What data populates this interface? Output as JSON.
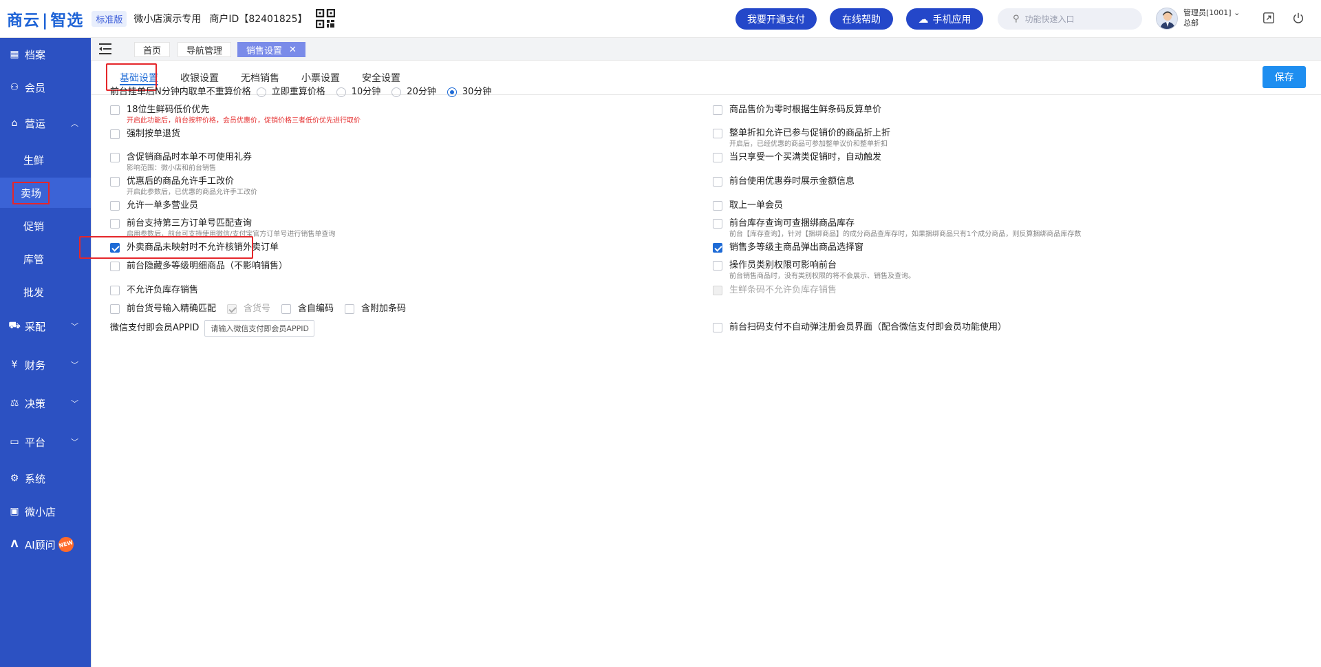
{
  "header": {
    "logo_left": "商云",
    "logo_right": "智选",
    "edition": "标准版",
    "store": "微小店演示专用",
    "merchant": "商户ID【82401825】",
    "btn_pay": "我要开通支付",
    "btn_help": "在线帮助",
    "btn_mobile": "手机应用",
    "search_placeholder": "功能快速入口",
    "user_name": "管理员[1001]",
    "user_dept": "总部"
  },
  "sidebar": {
    "items": [
      {
        "label": "档案",
        "icon": "archive-icon"
      },
      {
        "label": "会员",
        "icon": "member-icon"
      },
      {
        "label": "营运",
        "icon": "operation-icon"
      },
      {
        "label": "采配",
        "icon": "purchase-icon"
      },
      {
        "label": "财务",
        "icon": "finance-icon"
      },
      {
        "label": "决策",
        "icon": "decision-icon"
      },
      {
        "label": "平台",
        "icon": "platform-icon"
      },
      {
        "label": "系统",
        "icon": "system-icon"
      },
      {
        "label": "微小店",
        "icon": "shop-icon"
      },
      {
        "label": "AI顾问",
        "icon": "ai-icon"
      }
    ],
    "subitems": [
      "生鲜",
      "卖场",
      "促销",
      "库管",
      "批发"
    ],
    "new_badge": "NEW"
  },
  "tabs": {
    "home": "首页",
    "nav": "导航管理",
    "sales": "销售设置"
  },
  "settabs": [
    "基础设置",
    "收银设置",
    "无档销售",
    "小票设置",
    "安全设置"
  ],
  "save_label": "保存",
  "reprice": {
    "label": "前台挂单后N分钟内取单不重算价格",
    "options": [
      "立即重算价格",
      "10分钟",
      "20分钟",
      "30分钟"
    ],
    "selected": "30分钟"
  },
  "left": {
    "r1": {
      "label": "18位生鲜码低价优先",
      "note": "开启此功能后，前台按秤价格，会员优惠价，促销价格三者低价优先进行取价"
    },
    "r2": {
      "label": "强制按单退货"
    },
    "r3": {
      "label": "含促销商品时本单不可使用礼券",
      "note": "影响范围：微小店和前台销售"
    },
    "r4": {
      "label": "优惠后的商品允许手工改价",
      "note": "开启此参数后，已优惠的商品允许手工改价"
    },
    "r5": {
      "label": "允许一单多营业员"
    },
    "r6": {
      "label": "前台支持第三方订单号匹配查询",
      "note": "启用参数后，前台可支持使用微信/支付宝官方订单号进行销售单查询"
    },
    "r7": {
      "label": "外卖商品未映射时不允许核销外卖订单"
    },
    "r8": {
      "label": "前台隐藏多等级明细商品（不影响销售）"
    },
    "r9": {
      "label": "不允许负库存销售"
    },
    "r10": {
      "label": "前台货号输入精确匹配",
      "opt1": "含货号",
      "opt2": "含自编码",
      "opt3": "含附加条码"
    },
    "appid": {
      "label": "微信支付即会员APPID",
      "placeholder": "请输入微信支付即会员APPID"
    }
  },
  "right": {
    "r1": {
      "label": "商品售价为零时根据生鲜条码反算单价"
    },
    "r2": {
      "label": "整单折扣允许已参与促销价的商品折上折",
      "note": "开启后，已经优惠的商品可参加整单议价和整单折扣"
    },
    "r3": {
      "label": "当只享受一个买满类促销时，自动触发"
    },
    "r4": {
      "label": "前台使用优惠券时展示金额信息"
    },
    "r5": {
      "label": "取上一单会员"
    },
    "r6": {
      "label": "前台库存查询可查捆绑商品库存",
      "note": "前台【库存查询】，针对【捆绑商品】的成分商品查库存时，如果捆绑商品只有1个成分商品，则反算捆绑商品库存数"
    },
    "r7": {
      "label": "销售多等级主商品弹出商品选择窗"
    },
    "r8": {
      "label": "操作员类别权限可影响前台",
      "note": "前台销售商品时，没有类别权限的将不会展示、销售及查询。"
    },
    "r9": {
      "label": "生鲜条码不允许负库存销售"
    },
    "r10": {
      "label": "前台扫码支付不自动弹注册会员界面（配合微信支付即会员功能使用）"
    }
  }
}
